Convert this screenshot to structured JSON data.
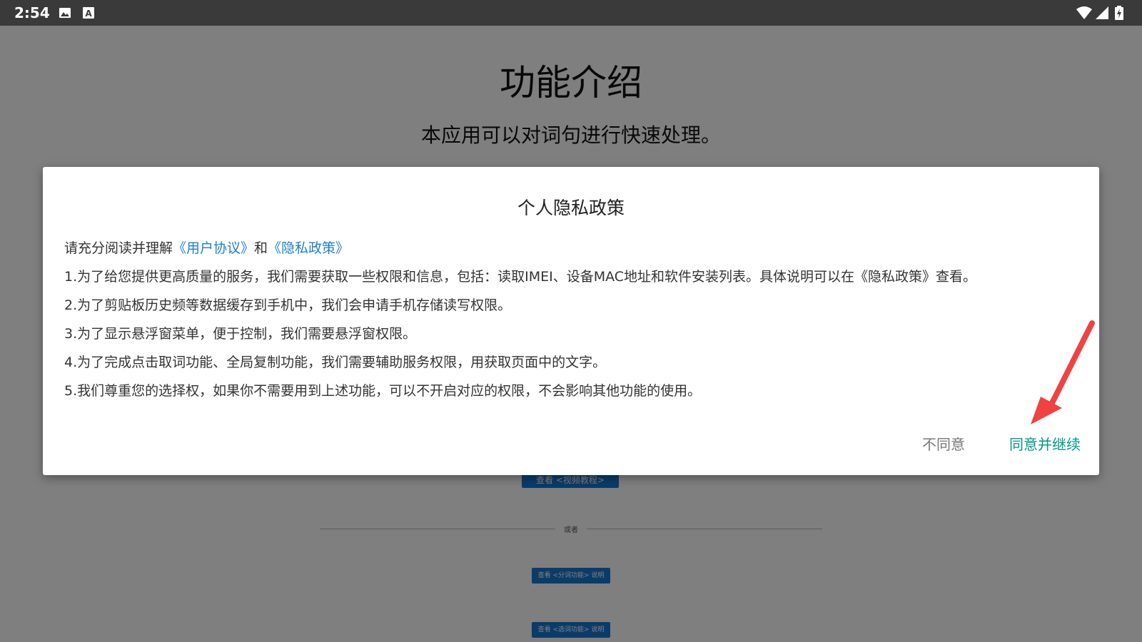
{
  "status_bar": {
    "time": "2:54",
    "left_icons": [
      "image-icon",
      "font-icon"
    ],
    "right_icons": [
      "wifi-icon",
      "signal-icon",
      "battery-charging-icon"
    ]
  },
  "background_page": {
    "title": "功能介绍",
    "subtitle": "本应用可以对词句进行快速处理。",
    "video_button": "查看 <视频教程>",
    "divider_text": "或者",
    "split_button": "查看 <分词功能> 说明",
    "select_button": "查看 <选词功能> 说明"
  },
  "dialog": {
    "title": "个人隐私政策",
    "intro_prefix": "请充分阅读并理解",
    "user_agreement_link": "《用户协议》",
    "intro_and": "和",
    "privacy_policy_link": "《隐私政策》",
    "items": [
      "1.为了给您提供更高质量的服务，我们需要获取一些权限和信息，包括：读取IMEI、设备MAC地址和软件安装列表。具体说明可以在《隐私政策》查看。",
      "2.为了剪贴板历史频等数据缓存到手机中，我们会申请手机存储读写权限。",
      "3.为了显示悬浮窗菜单，便于控制，我们需要悬浮窗权限。",
      "4.为了完成点击取词功能、全局复制功能，我们需要辅助服务权限，用获取页面中的文字。",
      "5.我们尊重您的选择权，如果你不需要用到上述功能，可以不开启对应的权限，不会影响其他功能的使用。"
    ],
    "disagree_label": "不同意",
    "agree_label": "同意并继续"
  },
  "colors": {
    "link": "#1e7fcf",
    "agree": "#009688",
    "disagree": "#777777",
    "status_bar": "#3a3a3a",
    "bg_button": "#1976d2",
    "annotation_arrow": "#f24141"
  }
}
